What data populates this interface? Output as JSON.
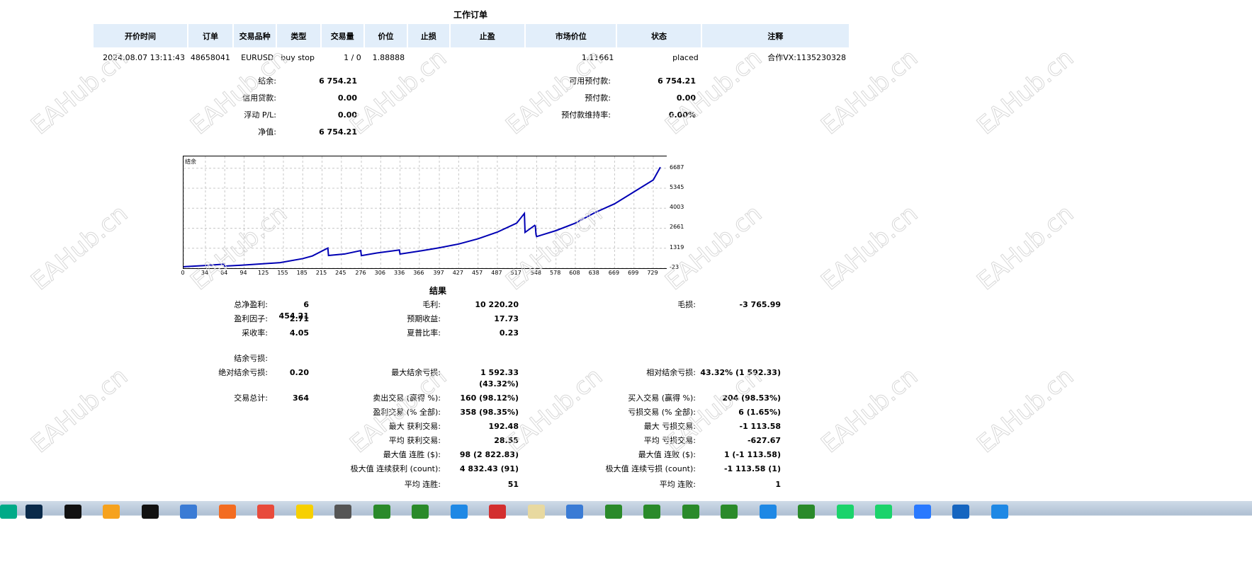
{
  "title": "工作订单",
  "orders": {
    "headers": [
      "开价时间",
      "订单",
      "交易品种",
      "类型",
      "交易量",
      "价位",
      "止损",
      "止盈",
      "市场价位",
      "状态",
      "注释"
    ],
    "rows": [
      [
        "2024.08.07 13:11:43",
        "48658041",
        "EURUSD",
        "buy stop",
        "1 / 0",
        "1.88888",
        "",
        "",
        "1.11661",
        "placed",
        "合作VX:1135230328"
      ]
    ]
  },
  "account": {
    "left": [
      [
        "结余:",
        "6 754.21"
      ],
      [
        "信用贷款:",
        "0.00"
      ],
      [
        "浮动 P/L:",
        "0.00"
      ],
      [
        "净值:",
        "6 754.21"
      ]
    ],
    "right": [
      [
        "可用预付款:",
        "6 754.21"
      ],
      [
        "预付款:",
        "0.00"
      ],
      [
        "预付款维持率:",
        "0.00%"
      ]
    ]
  },
  "chart_data": {
    "type": "line",
    "title": "结余",
    "series": [
      {
        "name": "结余",
        "x": [
          0,
          30,
          63,
          64,
          90,
          150,
          185,
          200,
          224,
          225,
          250,
          275,
          276,
          300,
          335,
          336,
          370,
          397,
          427,
          457,
          487,
          517,
          529,
          530,
          545,
          546,
          547,
          548,
          578,
          608,
          638,
          669,
          699,
          729,
          740
        ],
        "values": [
          80,
          150,
          250,
          120,
          180,
          350,
          620,
          800,
          1330,
          830,
          930,
          1160,
          820,
          1000,
          1200,
          930,
          1150,
          1350,
          1600,
          1950,
          2400,
          3000,
          3650,
          2380,
          2850,
          2800,
          2250,
          2100,
          2500,
          3000,
          3700,
          4300,
          5100,
          5900,
          6754
        ]
      }
    ],
    "yticks": [
      "6687",
      "5345",
      "4003",
      "2661",
      "1319",
      "-23"
    ],
    "yvals": [
      6687,
      5345,
      4003,
      2661,
      1319,
      -23
    ],
    "xticks": [
      "0",
      "34",
      "64",
      "94",
      "125",
      "155",
      "185",
      "215",
      "245",
      "276",
      "306",
      "336",
      "366",
      "397",
      "427",
      "457",
      "487",
      "517",
      "548",
      "578",
      "608",
      "638",
      "669",
      "699",
      "729"
    ],
    "xlim": [
      0,
      740
    ],
    "ylim": [
      -23,
      7480
    ],
    "grid": true,
    "color": "#0000b4"
  },
  "results": {
    "title": "结果",
    "rows": [
      [
        [
          "总净盈利:",
          "6 454.21"
        ],
        [
          "毛利:",
          "10 220.20"
        ],
        [
          "毛损:",
          "-3 765.99"
        ]
      ],
      [
        [
          "盈利因子:",
          "2.71"
        ],
        [
          "预期收益:",
          "17.73"
        ],
        null
      ],
      [
        [
          "采收率:",
          "4.05"
        ],
        [
          "夏普比率:",
          "0.23"
        ],
        null
      ],
      [
        [
          "结余亏损:",
          ""
        ],
        null,
        null
      ],
      [
        [
          "绝对结余亏损:",
          "0.20"
        ],
        [
          "最大结余亏损:",
          "1 592.33 (43.32%)"
        ],
        [
          "相对结余亏损:",
          "43.32% (1 592.33)"
        ]
      ],
      [
        [
          "交易总计:",
          "364"
        ],
        [
          "卖出交易 (赢得 %):",
          "160 (98.12%)"
        ],
        [
          "买入交易 (赢得 %):",
          "204 (98.53%)"
        ]
      ],
      [
        null,
        [
          "盈利交易 (% 全部):",
          "358 (98.35%)"
        ],
        [
          "亏损交易 (% 全部):",
          "6 (1.65%)"
        ]
      ],
      [
        null,
        [
          "最大 获利交易:",
          "192.48"
        ],
        [
          "最大 亏损交易:",
          "-1 113.58"
        ]
      ],
      [
        null,
        [
          "平均 获利交易:",
          "28.55"
        ],
        [
          "平均 亏损交易:",
          "-627.67"
        ]
      ],
      [
        null,
        [
          "最大值 连胜 ($):",
          "98 (2 822.83)"
        ],
        [
          "最大值 连败 ($):",
          "1 (-1 113.58)"
        ]
      ],
      [
        null,
        [
          "极大值 连续获利 (count):",
          "4 832.43 (91)"
        ],
        [
          "极大值 连续亏损 (count):",
          "-1 113.58 (1)"
        ]
      ],
      [
        null,
        [
          "平均 连胜:",
          "51"
        ],
        [
          "平均 连败:",
          "1"
        ]
      ]
    ]
  },
  "watermark": "EAHub.cn",
  "taskbar": {
    "icons": [
      "app",
      "photoshop-icon",
      "capcut-icon",
      "app-icon",
      "qq-icon",
      "doc-icon",
      "app-icon",
      "app-icon",
      "app-icon",
      "app-icon",
      "mt4-icon",
      "mt4-icon",
      "app-icon",
      "pdf-icon",
      "folder-icon",
      "doc-icon",
      "mt4-icon",
      "mt4-icon",
      "mt4-icon",
      "mt4-icon",
      "app-icon",
      "mt4-icon",
      "iqiyi-icon",
      "iqiyi-icon",
      "video-icon",
      "browser-icon",
      "sogou-icon"
    ],
    "colors": [
      "#0a8",
      "#0a2a4a",
      "#111",
      "#f6a21e",
      "#111",
      "#3a7bd5",
      "#f36c21",
      "#e84b3c",
      "#f7d000",
      "#555",
      "#2a8a2a",
      "#2a8a2a",
      "#1e88e5",
      "#d32f2f",
      "#e8d9a0",
      "#3a7bd5",
      "#2a8a2a",
      "#2a8a2a",
      "#2a8a2a",
      "#2a8a2a",
      "#1e88e5",
      "#2a8a2a",
      "#1bd36b",
      "#1bd36b",
      "#2979ff",
      "#1565c0",
      "#1e88e5"
    ]
  }
}
